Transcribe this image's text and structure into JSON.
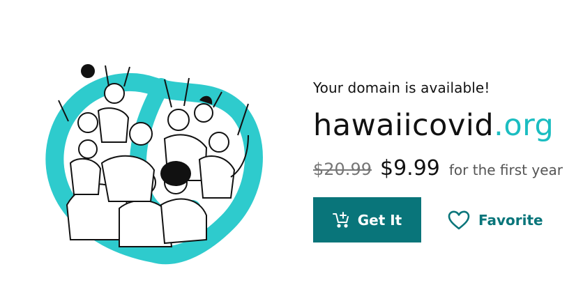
{
  "domain_result": {
    "availability_text": "Your domain is available!",
    "domain_name": "hawaiicovid",
    "tld": ".org",
    "original_price": "$20.99",
    "sale_price": "$9.99",
    "term": "for the first year"
  },
  "actions": {
    "get_it_label": "Get It",
    "favorite_label": "Favorite"
  },
  "icons": {
    "cart": "cart-plus-icon",
    "favorite": "heart-outline-icon"
  },
  "colors": {
    "accent_teal": "#09757a",
    "tld_teal": "#1bbdc1",
    "illustration_ring": "#2ecbcd"
  }
}
